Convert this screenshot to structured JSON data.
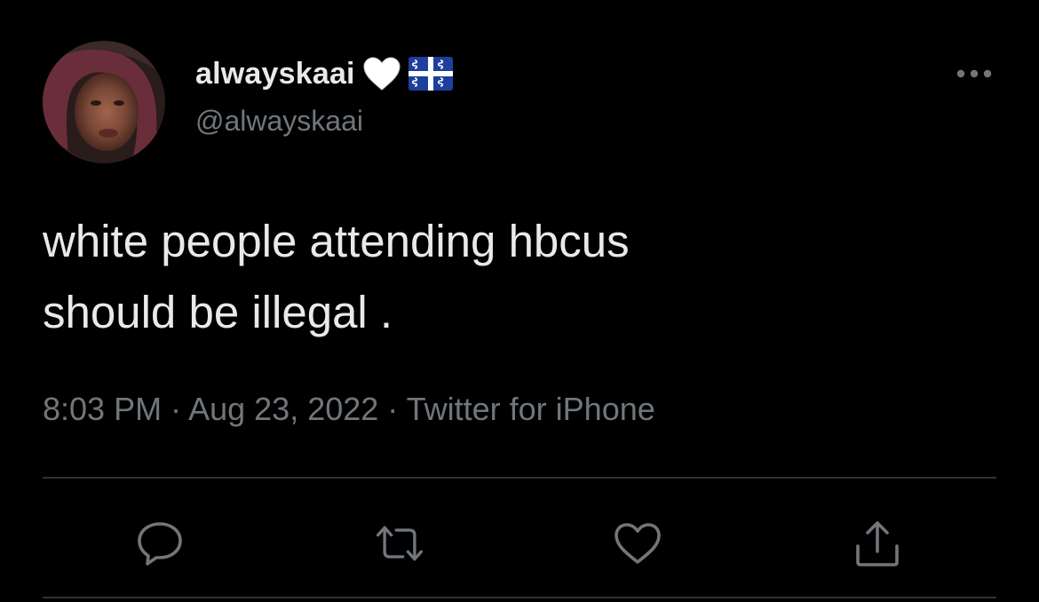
{
  "author": {
    "display_name": "alwayskaai",
    "handle": "@alwayskaai",
    "name_emojis": [
      "white-heart-icon",
      "martinique-flag-icon"
    ]
  },
  "tweet": {
    "text": "white people attending hbcus\nshould be illegal .",
    "time": "8:03 PM",
    "separator": " · ",
    "date": "Aug 23, 2022",
    "source": "Twitter for iPhone"
  },
  "actions": [
    "reply-icon",
    "retweet-icon",
    "like-icon",
    "share-icon"
  ],
  "colors": {
    "background": "#000000",
    "primary_text": "#E7E9EA",
    "secondary_text": "#71767B",
    "divider": "#2F3336"
  }
}
